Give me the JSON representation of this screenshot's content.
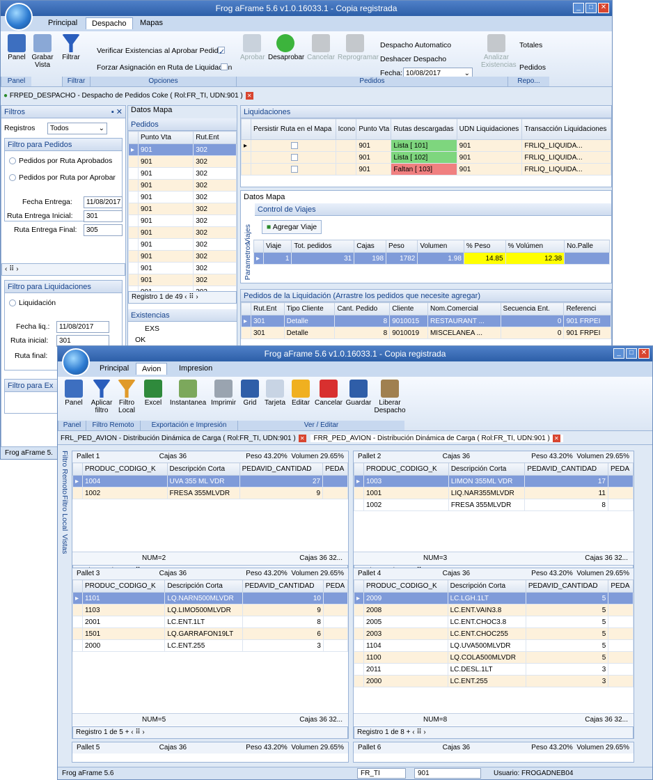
{
  "win1": {
    "title": "Frog aFrame 5.6 v1.0.16033.1 - Copia registrada",
    "tabs": [
      "Principal",
      "Despacho",
      "Mapas"
    ],
    "ribbon": {
      "panel": "Panel",
      "grabar": "Grabar Vista",
      "filtrar": "Filtrar",
      "verificar": "Verificar Existencias al Aprobar Pedido",
      "forzar": "Forzar Asignación en Ruta de Liquidación",
      "aprobar": "Aprobar",
      "desaprobar": "Desaprobar",
      "cancelar": "Cancelar",
      "reprogramar": "Reprogramar",
      "despacho_auto": "Despacho Automatico",
      "deshacer": "Deshacer Despacho",
      "fecha_label": "Fecha:",
      "fecha": "10/08/2017",
      "analizar": "Analizar Existencias",
      "totales": "Totales",
      "pedidos": "Pedidos",
      "groups": {
        "panel": "Panel",
        "filtrar": "Filtrar",
        "opciones": "Opciones",
        "pedidos": "Pedidos",
        "repo": "Repo..."
      }
    },
    "doc_tab": "FRPED_DESPACHO - Despacho de Pedidos Coke ( Rol:FR_TI, UDN:901 )",
    "filtros": {
      "title": "Filtros",
      "registros_label": "Registros",
      "registros": "Todos",
      "pedidos_group": "Filtro para Pedidos",
      "radio1": "Pedidos por Ruta Aprobados",
      "radio2": "Pedidos por Ruta por Aprobar",
      "fecha_entrega_label": "Fecha Entrega:",
      "fecha_entrega": "11/08/2017",
      "ruta_ini_label": "Ruta Entrega Inicial:",
      "ruta_ini": "301",
      "ruta_fin_label": "Ruta Entrega Final:",
      "ruta_fin": "305",
      "liq_group": "Filtro para Liquidaciones",
      "liq_radio": "Liquidación",
      "fecha_liq_label": "Fecha liq.:",
      "fecha_liq": "11/08/2017",
      "ruta_inicial_label": "Ruta inicial:",
      "ruta_inicial": "301",
      "ruta_final_label": "Ruta final:",
      "filtro_ex": "Filtro para Ex"
    },
    "pedidos": {
      "tabs": [
        "Datos",
        "Mapa"
      ],
      "title": "Pedidos",
      "cols": [
        "Punto Vta",
        "Rut.Ent"
      ],
      "rows": [
        [
          "901",
          "302"
        ],
        [
          "901",
          "302"
        ],
        [
          "901",
          "302"
        ],
        [
          "901",
          "302"
        ],
        [
          "901",
          "302"
        ],
        [
          "901",
          "302"
        ],
        [
          "901",
          "302"
        ],
        [
          "901",
          "302"
        ],
        [
          "901",
          "302"
        ],
        [
          "901",
          "302"
        ],
        [
          "901",
          "302"
        ],
        [
          "901",
          "302"
        ],
        [
          "901",
          "302"
        ]
      ],
      "pager": "Registro 1 de 49",
      "existencias": "Existencias",
      "exs_col": "EXS",
      "exs_val": "OK"
    },
    "liq": {
      "title": "Liquidaciones",
      "cols": [
        "Persistir Ruta en el Mapa",
        "Icono",
        "Punto Vta",
        "Rutas descargadas",
        "UDN Liquidaciones",
        "Transacción Liquidaciones"
      ],
      "rows": [
        [
          "901",
          "Lista [ 101]",
          "901",
          "FRLIQ_LIQUIDA..."
        ],
        [
          "901",
          "Lista [ 102]",
          "901",
          "FRLIQ_LIQUIDA..."
        ],
        [
          "901",
          "Faltan [ 103]",
          "901",
          "FRLIQ_LIQUIDA..."
        ]
      ]
    },
    "viajes": {
      "tabs": [
        "Datos",
        "Mapa"
      ],
      "title": "Control de Viajes",
      "agregar": "Agregar Viaje",
      "side1": "Viajes",
      "side2": "Parametros",
      "cols": [
        "Viaje",
        "Tot. pedidos",
        "Cajas",
        "Peso",
        "Volumen",
        "% Peso",
        "% Volúmen",
        "No.Palle"
      ],
      "row": [
        "1",
        "31",
        "198",
        "1782",
        "1.98",
        "14.85",
        "12.38",
        ""
      ]
    },
    "pedliq": {
      "title": "Pedidos de la Liquidación (Arrastre los pedidos que necesite agregar)",
      "cols": [
        "Rut.Ent",
        "Tipo Cliente",
        "Cant. Pedido",
        "Cliente",
        "Nom.Comercial",
        "Secuencia Ent.",
        "Referenci"
      ],
      "rows": [
        [
          "301",
          "Detalle",
          "8",
          "9010015",
          "RESTAURANT ...",
          "0",
          "901 FRPEI"
        ],
        [
          "301",
          "Detalle",
          "8",
          "9010019",
          "MISCELANEA ...",
          "0",
          "901 FRPEI"
        ]
      ]
    },
    "status": "Frog aFrame 5."
  },
  "win2": {
    "title": "Frog aFrame 5.6 v1.0.16033.1 - Copia registrada",
    "tabs": [
      "Principal",
      "Avion",
      "Impresion"
    ],
    "ribbon": {
      "panel": "Panel",
      "aplicar": "Aplicar filtro",
      "filtro_local": "Filtro Local",
      "excel": "Excel",
      "instantanea": "Instantanea",
      "imprimir": "Imprimir",
      "grid": "Grid",
      "tarjeta": "Tarjeta",
      "editar": "Editar",
      "cancelar": "Cancelar",
      "guardar": "Guardar",
      "liberar": "Liberar Despacho",
      "groups": {
        "panel": "Panel",
        "filtro": "Filtro Remoto",
        "export": "Exportación e Impresión",
        "ver": "Ver / Editar"
      }
    },
    "doc_tab1": "FRL_PED_AVION - Distribución Dinámica de Carga ( Rol:FR_TI, UDN:901 )",
    "doc_tab2": "FRR_PED_AVION - Distribución Dinámica de Carga ( Rol:FR_TI, UDN:901 )",
    "side": [
      "Filtro Remoto",
      "Filtro Local",
      "Vistas"
    ],
    "cols": [
      "PRODUC_CODIGO_K",
      "Descripción Corta",
      "PEDAVID_CANTIDAD",
      "PEDA"
    ],
    "pallets": [
      {
        "name": "Pallet 1",
        "cajas": "Cajas 36",
        "peso": "Peso 43.20%",
        "vol": "Volumen 29.65%",
        "rows": [
          [
            "1004",
            "UVA 355 ML VDR",
            "27"
          ],
          [
            "1002",
            "FRESA 355MLVDR",
            "9"
          ]
        ],
        "num": "NUM=2",
        "foot": "Cajas 36  32...",
        "pager": "Registro 1 de 2"
      },
      {
        "name": "Pallet 2",
        "cajas": "Cajas 36",
        "peso": "Peso 43.20%",
        "vol": "Volumen 29.65%",
        "rows": [
          [
            "1003",
            "LIMON 355ML VDR",
            "17"
          ],
          [
            "1001",
            "LIQ.NAR355MLVDR",
            "11"
          ],
          [
            "1002",
            "FRESA 355MLVDR",
            "8"
          ]
        ],
        "num": "NUM=3",
        "foot": "Cajas 36  32...",
        "pager": "Registro 1 de 3"
      },
      {
        "name": "Pallet 3",
        "cajas": "Cajas 36",
        "peso": "Peso 43.20%",
        "vol": "Volumen 29.65%",
        "rows": [
          [
            "1101",
            "LQ.NARN500MLVDR",
            "10"
          ],
          [
            "1103",
            "LQ.LIMO500MLVDR",
            "9"
          ],
          [
            "2001",
            "LC.ENT.1LT",
            "8"
          ],
          [
            "1501",
            "LQ.GARRAFON19LT",
            "6"
          ],
          [
            "2000",
            "LC.ENT.255",
            "3"
          ]
        ],
        "num": "NUM=5",
        "foot": "Cajas 36  32...",
        "pager": "Registro 1 de 5"
      },
      {
        "name": "Pallet 4",
        "cajas": "Cajas 36",
        "peso": "Peso 43.20%",
        "vol": "Volumen 29.65%",
        "rows": [
          [
            "2009",
            "LC.LGH.1LT",
            "5"
          ],
          [
            "2008",
            "LC.ENT.VAIN3.8",
            "5"
          ],
          [
            "2005",
            "LC.ENT.CHOC3.8",
            "5"
          ],
          [
            "2003",
            "LC.ENT.CHOC255",
            "5"
          ],
          [
            "1104",
            "LQ.UVA500MLVDR",
            "5"
          ],
          [
            "1100",
            "LQ.COLA500MLVDR",
            "5"
          ],
          [
            "2011",
            "LC.DESL.1LT",
            "3"
          ],
          [
            "2000",
            "LC.ENT.255",
            "3"
          ]
        ],
        "num": "NUM=8",
        "foot": "Cajas 36  32...",
        "pager": "Registro 1 de 8"
      },
      {
        "name": "Pallet 5",
        "cajas": "Cajas 36",
        "peso": "Peso 43.20%",
        "vol": "Volumen 29.65%"
      },
      {
        "name": "Pallet 6",
        "cajas": "Cajas 36",
        "peso": "Peso 43.20%",
        "vol": "Volumen 29.65%"
      }
    ],
    "status": {
      "app": "Frog aFrame 5.6",
      "rol": "FR_TI",
      "udn": "901",
      "usuario": "Usuario: FROGADNEB04"
    }
  }
}
